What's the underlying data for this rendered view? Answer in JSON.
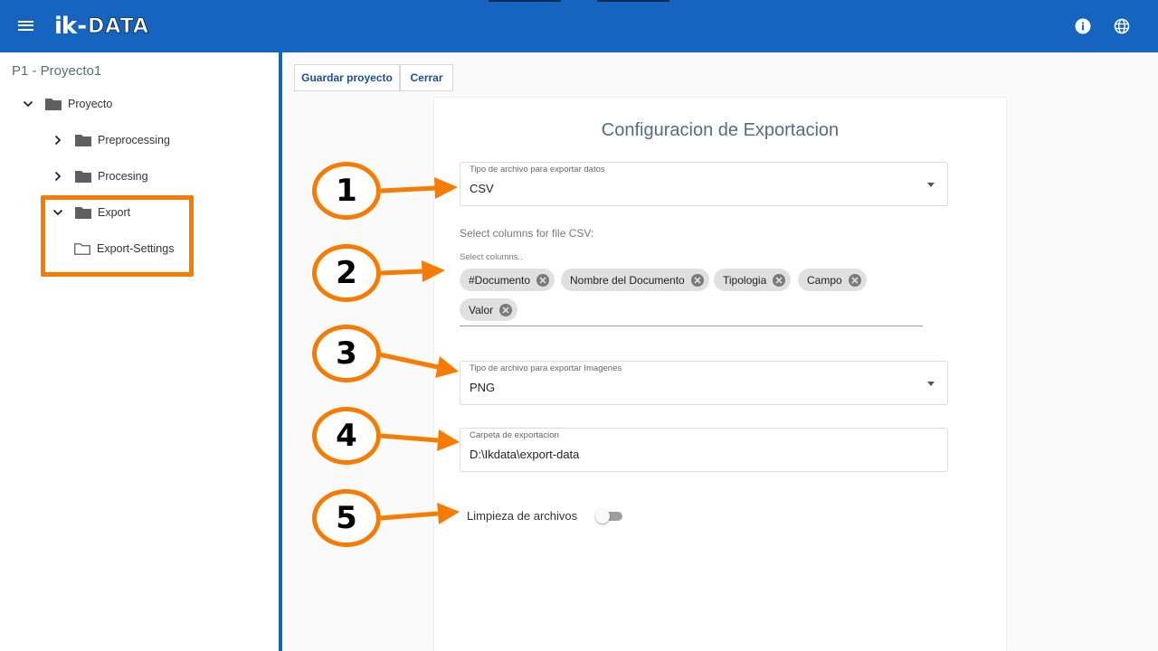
{
  "app": {
    "brand": {
      "ik": "ik",
      "dash": "-",
      "data": "DATA"
    }
  },
  "sidebar": {
    "project_title": "P1 - Proyecto1",
    "tree": [
      {
        "label": "Proyecto"
      },
      {
        "label": "Preprocessing"
      },
      {
        "label": "Procesing"
      },
      {
        "label": "Export"
      },
      {
        "label": "Export-Settings"
      }
    ]
  },
  "toolbar": {
    "save_label": "Guardar proyecto",
    "close_label": "Cerrar"
  },
  "export_config": {
    "title": "Configuracion de Exportacion",
    "data_type": {
      "label": "Tipo de archivo para exportar datos",
      "value": "CSV"
    },
    "columns": {
      "help": "Select columns for file CSV:",
      "label": "Select columns..",
      "chips": [
        "#Documento",
        "Nombre del Documento",
        "Tipologia",
        "Campo",
        "Valor"
      ]
    },
    "image_type": {
      "label": "Tipo de archivo para exportar Imagenes",
      "value": "PNG"
    },
    "export_folder": {
      "label": "Carpeta de exportacion",
      "value": "D:\\Ikdata\\export-data"
    },
    "cleanup": {
      "label": "Limpieza de archivos",
      "enabled": false
    }
  },
  "annotations": [
    "1",
    "2",
    "3",
    "4",
    "5"
  ],
  "colors": {
    "header": "#1565c0",
    "annotation": "#f57c00",
    "title": "#546e7a"
  }
}
